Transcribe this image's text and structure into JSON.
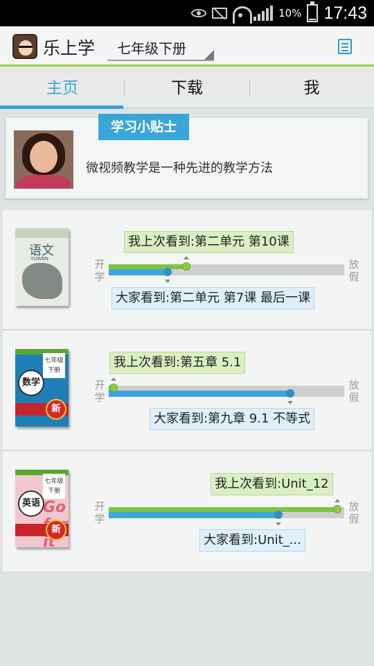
{
  "status_bar": {
    "battery_text": "10%",
    "battery_level": 0.1,
    "time": "17:43",
    "icons": [
      "eye-icon",
      "mute-icon",
      "wifi-icon",
      "signal-icon",
      "battery-icon"
    ]
  },
  "app_bar": {
    "title": "乐上学",
    "grade_selector": "七年级下册",
    "menu_icon": "list-icon"
  },
  "tabs": [
    {
      "label": "主页",
      "active": true
    },
    {
      "label": "下载",
      "active": false
    },
    {
      "label": "我",
      "active": false
    }
  ],
  "tip": {
    "badge": "学习小贴士",
    "text": "微视频教学是一种先进的教学方法"
  },
  "edge_labels": {
    "start": "开学",
    "end": "放假"
  },
  "books": [
    {
      "cover_title": "语文",
      "cover_sub": "YUWEN",
      "my_progress_label": "我上次看到:第二单元 第10课",
      "all_progress_label": "大家看到:第二单元 第7课 最后一课",
      "my_progress": 0.33,
      "all_progress": 0.25
    },
    {
      "cover_title": "数学",
      "cover_panel": "七年级 下册",
      "cover_badge": "新",
      "my_progress_label": "我上次看到:第五章 5.1",
      "all_progress_label": "大家看到:第九章 9.1 不等式",
      "my_progress": 0.02,
      "all_progress": 0.77
    },
    {
      "cover_title": "英语",
      "cover_panel": "七年级 下册",
      "cover_badge": "新",
      "cover_art": "Go for it",
      "my_progress_label": "我上次看到:Unit_12",
      "all_progress_label": "大家看到:Unit_...",
      "my_progress": 0.97,
      "all_progress": 0.72
    }
  ],
  "colors": {
    "accent_blue": "#3aa3d6",
    "progress_green": "#7ec242",
    "progress_blue": "#3da5d8",
    "appbar_underline": "#9dd04a"
  }
}
